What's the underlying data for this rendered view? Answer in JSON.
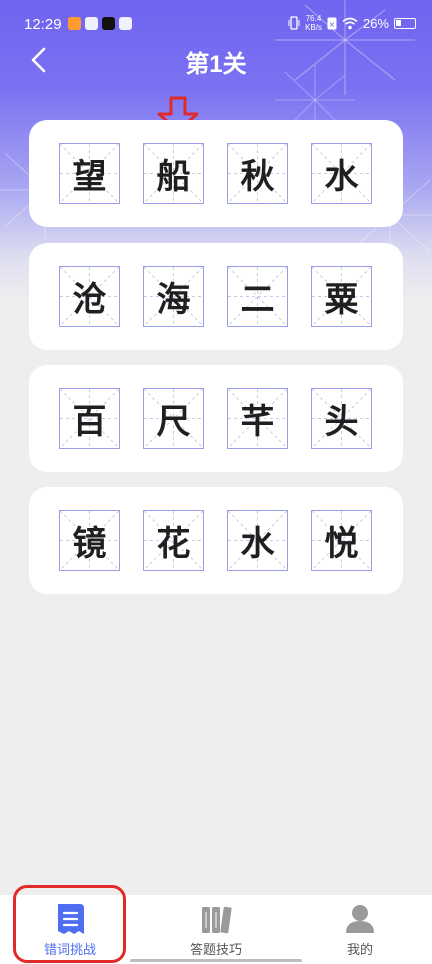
{
  "status_bar": {
    "time": "12:29",
    "net_speed_value": "76.4",
    "net_speed_unit": "KB/s",
    "battery_percent": "26%"
  },
  "header": {
    "title": "第1关"
  },
  "puzzle": {
    "rows": [
      {
        "chars": [
          "望",
          "船",
          "秋",
          "水"
        ]
      },
      {
        "chars": [
          "沧",
          "海",
          "二",
          "粟"
        ]
      },
      {
        "chars": [
          "百",
          "尺",
          "芊",
          "头"
        ]
      },
      {
        "chars": [
          "镜",
          "花",
          "水",
          "悦"
        ]
      }
    ]
  },
  "tabbar": {
    "tabs": [
      {
        "label": "错词挑战",
        "icon": "document-icon",
        "active": true
      },
      {
        "label": "答题技巧",
        "icon": "books-icon",
        "active": false
      },
      {
        "label": "我的",
        "icon": "user-icon",
        "active": false
      }
    ]
  },
  "colors": {
    "accent": "#4f6df0",
    "annotation_red": "#e12a2a",
    "grid_border": "#9a9ee6"
  }
}
